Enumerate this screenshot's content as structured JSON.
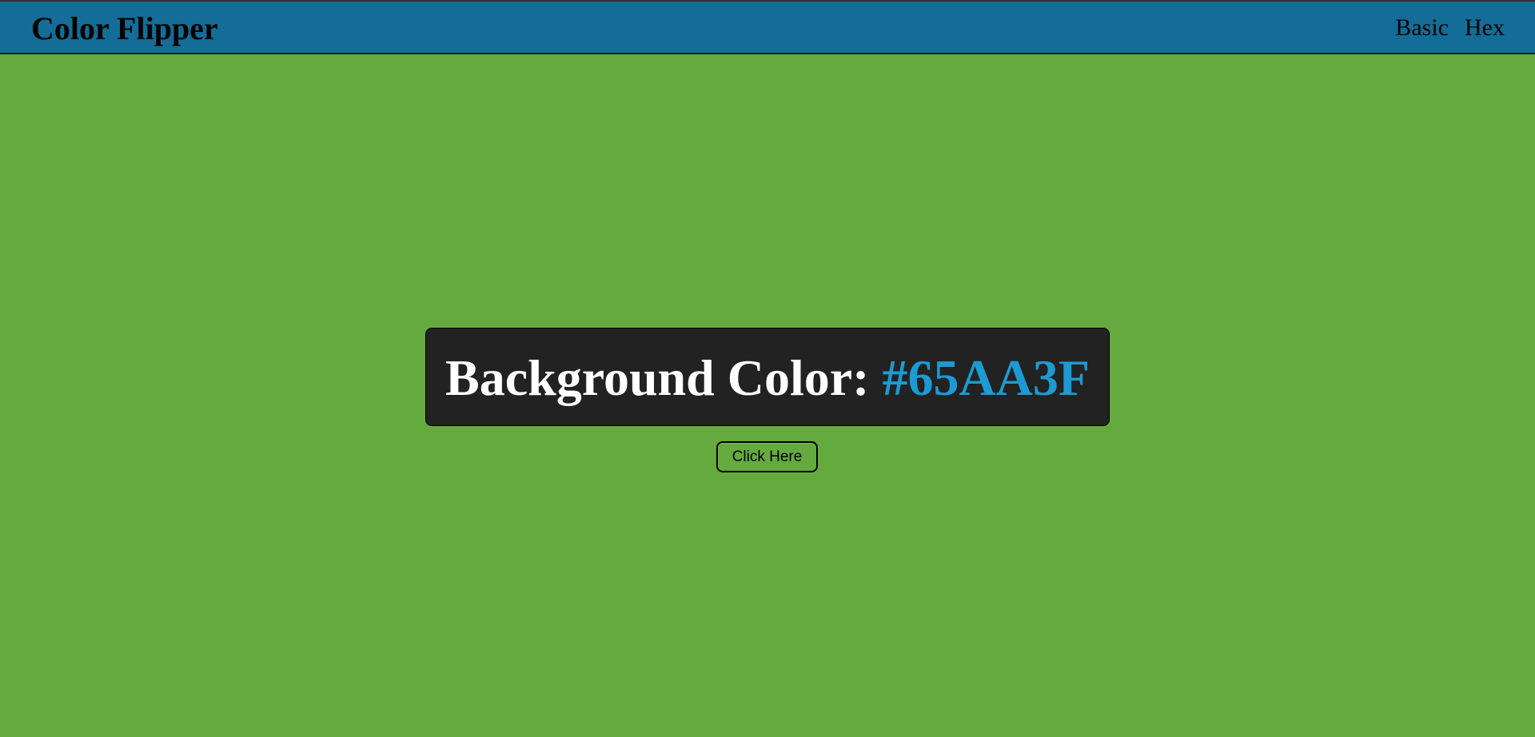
{
  "app": {
    "title": "Color Flipper"
  },
  "nav": {
    "items": [
      {
        "label": "Basic"
      },
      {
        "label": "Hex"
      }
    ]
  },
  "main": {
    "heading_label": "Background Color:",
    "color_value": "#65AA3F",
    "button_label": "Click Here"
  },
  "colors": {
    "page_background": "#65AA3F",
    "topbar": "#136D96",
    "panel": "#222222",
    "hex_text": "#1D9AD2",
    "heading_text": "#FFFFFF"
  }
}
